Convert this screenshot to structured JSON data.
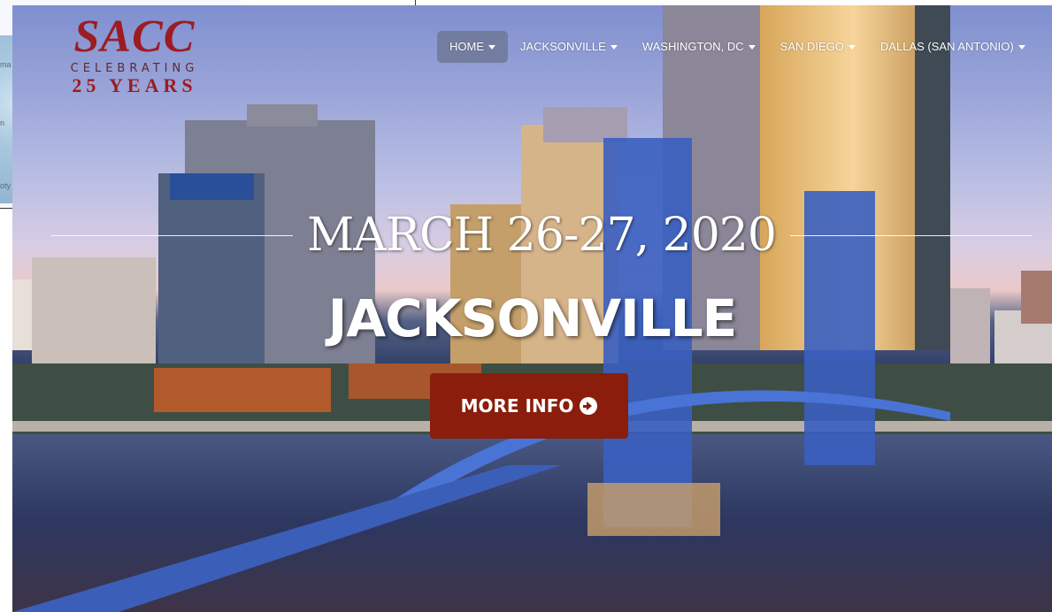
{
  "background_window": {
    "snippets": [
      "ma",
      "n",
      "oty"
    ]
  },
  "logo": {
    "name": "SACC",
    "tagline": "CELEBRATING",
    "years": "25 YEARS"
  },
  "nav": {
    "items": [
      {
        "label": "HOME",
        "active": true
      },
      {
        "label": "JACKSONVILLE",
        "active": false
      },
      {
        "label": "WASHINGTON, DC",
        "active": false
      },
      {
        "label": "SAN DIEGO",
        "active": false
      },
      {
        "label": "DALLAS (SAN ANTONIO)",
        "active": false
      }
    ]
  },
  "hero": {
    "date": "MARCH 26-27, 2020",
    "city": "JACKSONVILLE",
    "cta_label": "MORE INFO",
    "cta_icon": "circle-arrow-right-icon"
  },
  "colors": {
    "brand_red": "#9c1c24",
    "cta_bg": "#8a1d0b",
    "nav_active_bg": "#6e7896"
  }
}
